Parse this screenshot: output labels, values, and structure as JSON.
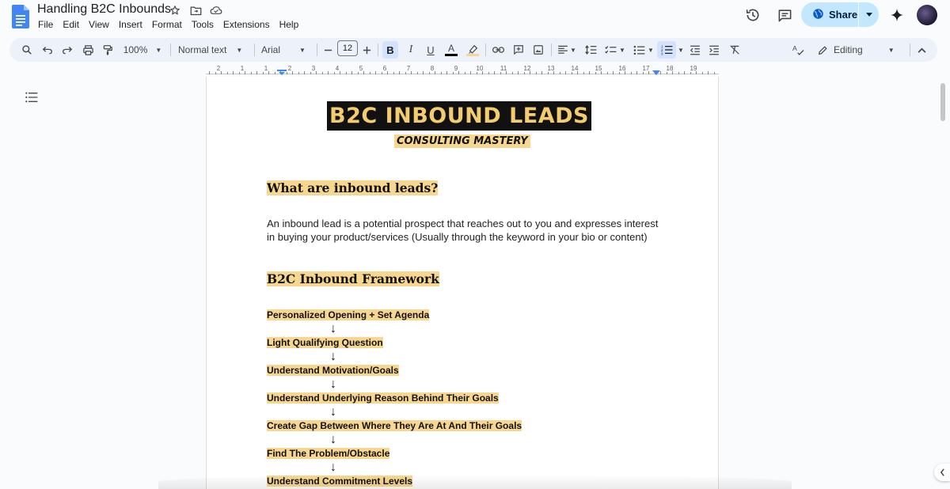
{
  "document": {
    "title": "Handling B2C Inbounds"
  },
  "menu": [
    "File",
    "Edit",
    "View",
    "Insert",
    "Format",
    "Tools",
    "Extensions",
    "Help"
  ],
  "header": {
    "share_label": "Share"
  },
  "toolbar": {
    "zoom": "100%",
    "style": "Normal text",
    "font": "Arial",
    "font_size": "12",
    "mode": "Editing",
    "icons": [
      "search-icon",
      "undo-icon",
      "redo-icon",
      "print-icon",
      "paint-format-icon",
      "bold-icon",
      "italic-icon",
      "underline-icon",
      "text-color-icon",
      "highlight-icon",
      "link-icon",
      "comment-icon",
      "image-icon",
      "align-icon",
      "line-spacing-icon",
      "checklist-icon",
      "bullet-list-icon",
      "numbered-list-icon",
      "indent-decrease-icon",
      "indent-increase-icon",
      "clear-format-icon",
      "spellcheck-icon",
      "pencil-icon",
      "collapse-icon"
    ],
    "bold_label": "B",
    "italic_label": "I",
    "underline_label": "U",
    "text_color_label": "A"
  },
  "ruler": {
    "numbers": [
      "2",
      "1",
      "1",
      "2",
      "3",
      "4",
      "5",
      "6",
      "7",
      "8",
      "9",
      "10",
      "11",
      "12",
      "13",
      "14",
      "15",
      "16",
      "17",
      "18",
      "19"
    ]
  },
  "content": {
    "banner_title": "B2C INBOUND LEADS",
    "banner_subtitle": "CONSULTING MASTERY",
    "heading1": "What are inbound leads?",
    "paragraph": "An inbound lead is a potential prospect that reaches out to you and expresses interest in buying your product/services (Usually through the keyword in your bio or content)",
    "heading2": "B2C Inbound Framework",
    "arrow": "↓",
    "steps": [
      "Personalized Opening + Set Agenda",
      "Light Qualifying Question",
      "Understand Motivation/Goals",
      "Understand Underlying Reason Behind Their Goals",
      "Create Gap Between Where They Are At And Their Goals",
      "Find The Problem/Obstacle",
      "Understand Commitment Levels"
    ]
  },
  "colors": {
    "highlight": "#f7d78f",
    "banner_bg": "#111111",
    "banner_text": "#f3cc6e",
    "share_bg": "#c2e7ff",
    "toolbar_bg": "#edf2fa"
  }
}
